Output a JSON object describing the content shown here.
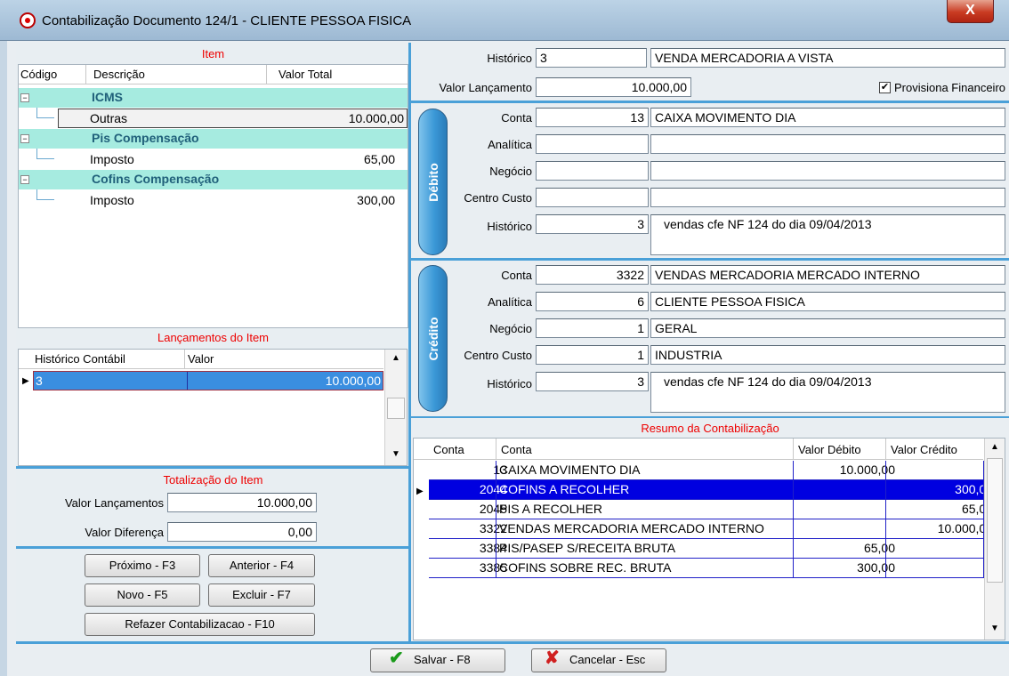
{
  "window": {
    "title": "Contabilização Documento 124/1 - CLIENTE PESSOA FISICA",
    "close": "X"
  },
  "item": {
    "title": "Item",
    "headers": {
      "codigo": "Código",
      "descricao": "Descrição",
      "valor_total": "Valor Total"
    },
    "groups": [
      {
        "name": "ICMS",
        "child_desc": "Outras",
        "child_value": "10.000,00"
      },
      {
        "name": "Pis Compensação",
        "child_desc": "Imposto",
        "child_value": "65,00"
      },
      {
        "name": "Cofins Compensação",
        "child_desc": "Imposto",
        "child_value": "300,00"
      }
    ]
  },
  "lancamentos": {
    "title": "Lançamentos do Item",
    "headers": {
      "historico": "Histórico Contábil",
      "valor": "Valor"
    },
    "rows": [
      {
        "historico": "3",
        "valor": "10.000,00"
      }
    ]
  },
  "totalizacao": {
    "title": "Totalização do Item",
    "valor_lancamentos_label": "Valor Lançamentos",
    "valor_lancamentos": "10.000,00",
    "valor_diferenca_label": "Valor Diferença",
    "valor_diferenca": "0,00"
  },
  "buttons": {
    "proximo": "Próximo - F3",
    "anterior": "Anterior - F4",
    "novo": "Novo - F5",
    "excluir": "Excluir - F7",
    "refazer": "Refazer Contabilizacao - F10",
    "salvar": "Salvar - F8",
    "cancelar": "Cancelar - Esc"
  },
  "header": {
    "historico_label": "Histórico",
    "historico_code": "3",
    "historico_desc": "VENDA MERCADORIA A VISTA",
    "valor_label": "Valor Lançamento",
    "valor": "10.000,00",
    "provisiona_label": "Provisiona Financeiro",
    "provisiona_checked": "✔"
  },
  "debito": {
    "title": "Débito",
    "conta_label": "Conta",
    "conta_code": "13",
    "conta_desc": "CAIXA MOVIMENTO DIA",
    "analitica_label": "Analítica",
    "analitica_code": "",
    "analitica_desc": "",
    "negocio_label": "Negócio",
    "negocio_code": "",
    "negocio_desc": "",
    "centro_label": "Centro Custo",
    "centro_code": "",
    "centro_desc": "",
    "historico_label": "Histórico",
    "historico_code": "3",
    "historico_desc": "vendas cfe  NF 124  do dia  09/04/2013"
  },
  "credito": {
    "title": "Crédito",
    "conta_label": "Conta",
    "conta_code": "3322",
    "conta_desc": "VENDAS MERCADORIA MERCADO INTERNO",
    "analitica_label": "Analítica",
    "analitica_code": "6",
    "analitica_desc": "CLIENTE PESSOA FISICA",
    "negocio_label": "Negócio",
    "negocio_code": "1",
    "negocio_desc": "GERAL",
    "centro_label": "Centro Custo",
    "centro_code": "1",
    "centro_desc": "INDUSTRIA",
    "historico_label": "Histórico",
    "historico_code": "3",
    "historico_desc": "vendas cfe  NF 124  do dia  09/04/2013"
  },
  "resumo": {
    "title": "Resumo da Contabilização",
    "headers": {
      "conta_code": "Conta",
      "conta_desc": "Conta",
      "debito": "Valor Débito",
      "credito": "Valor Crédito"
    },
    "rows": [
      {
        "code": "13",
        "desc": "CAIXA MOVIMENTO DIA",
        "debito": "10.000,00",
        "credito": ""
      },
      {
        "code": "2044",
        "desc": "COFINS A RECOLHER",
        "debito": "",
        "credito": "300,00"
      },
      {
        "code": "2045",
        "desc": "PIS A RECOLHER",
        "debito": "",
        "credito": "65,00"
      },
      {
        "code": "3322",
        "desc": "VENDAS MERCADORIA MERCADO INTERNO",
        "debito": "",
        "credito": "10.000,00"
      },
      {
        "code": "3384",
        "desc": "PIS/PASEP S/RECEITA BRUTA",
        "debito": "65,00",
        "credito": ""
      },
      {
        "code": "3385",
        "desc": "COFINS SOBRE REC. BRUTA",
        "debito": "300,00",
        "credito": ""
      }
    ]
  },
  "colors": {
    "accent_blue": "#4aa0d8",
    "tree_group": "#a6ebe0",
    "selection": "#0000e0",
    "section_title": "#e00000"
  }
}
